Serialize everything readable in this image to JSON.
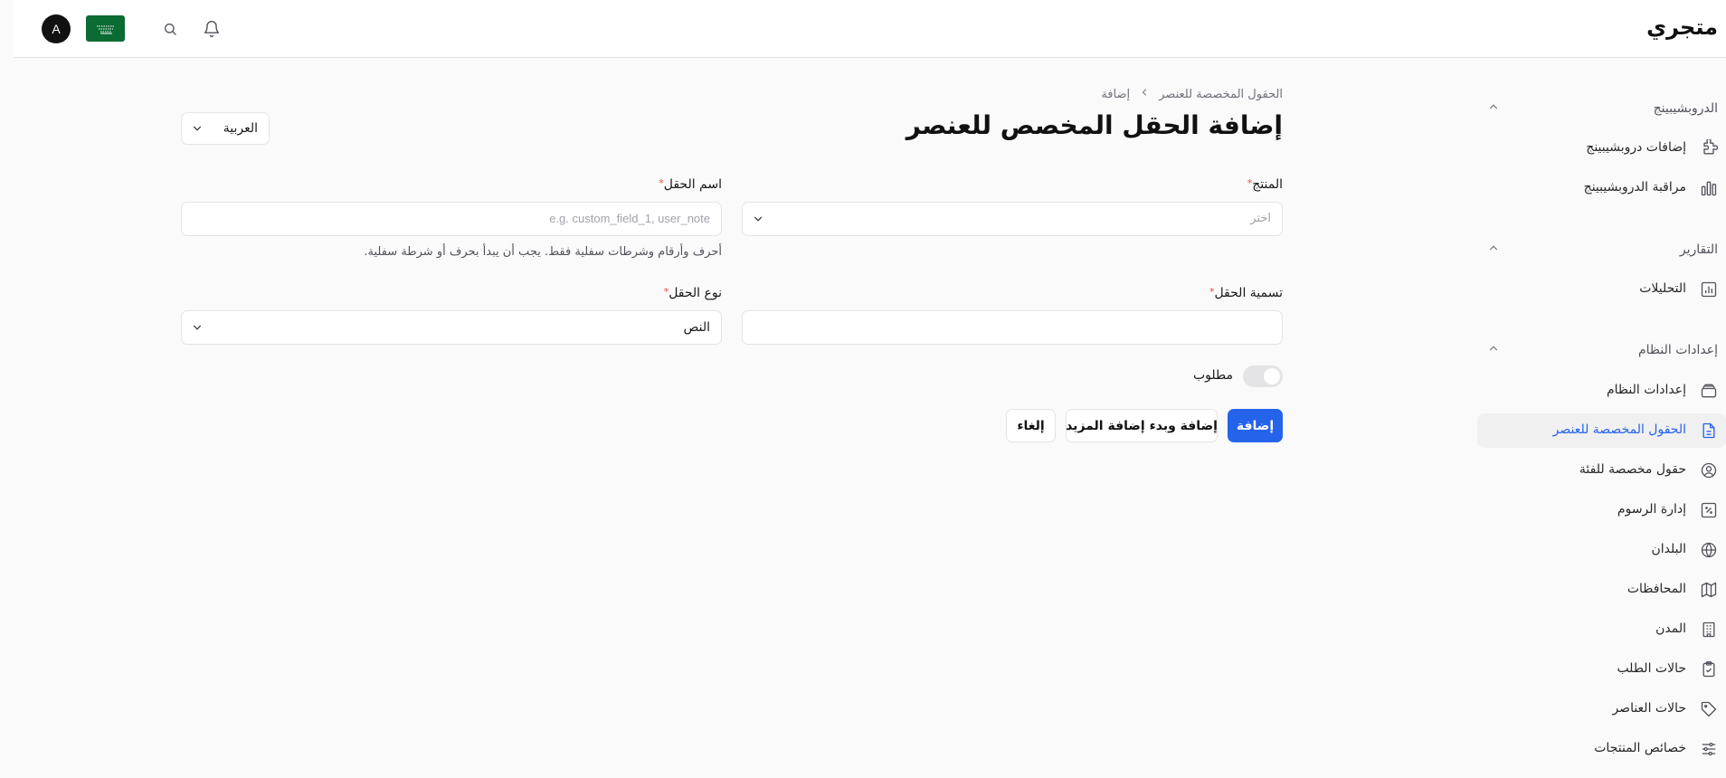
{
  "app": {
    "brand": "متجري",
    "avatar_initial": "A"
  },
  "header": {
    "icons": [
      "bell-icon",
      "search-icon",
      "saudi-flag",
      "avatar"
    ]
  },
  "sidebar": {
    "groups": [
      {
        "title": "الدروبشيبينج",
        "items": [
          {
            "label": "إضافات دروبشيبينج",
            "icon": "puzzle-icon"
          },
          {
            "label": "مراقبة الدروبشيبينج",
            "icon": "bar-chart-icon"
          }
        ]
      },
      {
        "title": "التقارير",
        "items": [
          {
            "label": "التحليلات",
            "icon": "analytics-icon"
          }
        ]
      },
      {
        "title": "إعدادات النظام",
        "items": [
          {
            "label": "إعدادات النظام",
            "icon": "archive-icon"
          },
          {
            "label": "الحقول المخصصة للعنصر",
            "icon": "document-icon",
            "active": true
          },
          {
            "label": "حقول مخصصة للفئة",
            "icon": "user-circle-icon"
          },
          {
            "label": "إدارة الرسوم",
            "icon": "percent-icon"
          },
          {
            "label": "البلدان",
            "icon": "globe-icon"
          },
          {
            "label": "المحافظات",
            "icon": "map-icon"
          },
          {
            "label": "المدن",
            "icon": "building-icon"
          },
          {
            "label": "حالات الطلب",
            "icon": "clipboard-check-icon"
          },
          {
            "label": "حالات العناصر",
            "icon": "tag-icon"
          },
          {
            "label": "خصائص المنتجات",
            "icon": "sliders-icon"
          }
        ]
      }
    ]
  },
  "breadcrumb": {
    "parent": "الحقول المخصصة للعنصر",
    "current": "إضافة"
  },
  "page": {
    "title": "إضافة الحقل المخصص للعنصر"
  },
  "language_select": {
    "value": "العربية"
  },
  "form": {
    "product": {
      "label": "المنتج",
      "placeholder": "اختر"
    },
    "field_name": {
      "label": "اسم الحقل",
      "placeholder": "e.g. custom_field_1, user_note",
      "hint": "أحرف وأرقام وشرطات سفلية فقط. يجب أن يبدأ بحرف أو شرطة سفلية."
    },
    "field_label": {
      "label": "تسمية الحقل",
      "value": ""
    },
    "field_type": {
      "label": "نوع الحقل",
      "value": "النص"
    },
    "required": {
      "label": "مطلوب",
      "checked": false
    },
    "required_marker": "*"
  },
  "actions": {
    "add": "إضافة",
    "add_and_more": "إضافة وبدء إضافة المزيد",
    "cancel": "إلغاء"
  },
  "colors": {
    "accent": "#2563eb",
    "required": "#ef4444",
    "flag": "#0a6b33"
  }
}
